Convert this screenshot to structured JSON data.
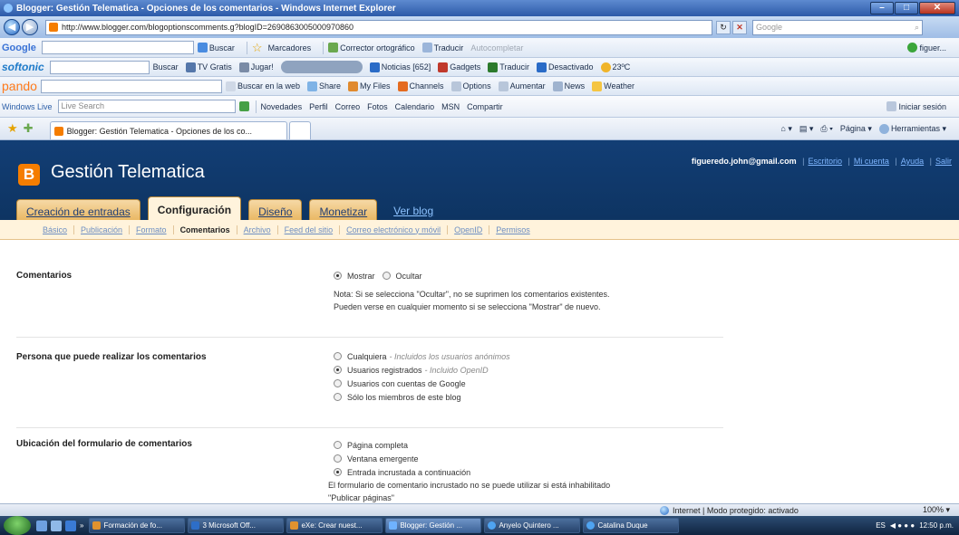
{
  "window": {
    "title": "Blogger: Gestión Telematica - Opciones de los comentarios - Windows Internet Explorer"
  },
  "address_bar": {
    "url": "http://www.blogger.com/blogoptionscomments.g?blogID=2690863005000970860",
    "search_placeholder": "Google"
  },
  "toolbar_google": {
    "brand": "Google",
    "buscar": "Buscar",
    "marcadores": "Marcadores",
    "corrector": "Corrector ortográfico",
    "traducir": "Traducir",
    "autocompletar": "Autocompletar",
    "user": "figuer..."
  },
  "toolbar_softonic": {
    "brand": "softonic",
    "buscar": "Buscar",
    "tvgratis": "TV Gratis",
    "jugar": "Jugar!",
    "noticias": "Noticias [652]",
    "gadgets": "Gadgets",
    "traducir": "Traducir",
    "desactivado": "Desactivado",
    "temp": "23ºC"
  },
  "toolbar_pando": {
    "brand": "pando",
    "buscar_web": "Buscar en la web",
    "share": "Share",
    "myfiles": "My Files",
    "channels": "Channels",
    "options": "Options",
    "aumentar": "Aumentar",
    "news": "News",
    "weather": "Weather"
  },
  "toolbar_wlive": {
    "brand": "Windows Live",
    "search_placeholder": "Live Search",
    "links": [
      "Novedades",
      "Perfil",
      "Correo",
      "Fotos",
      "Calendario",
      "MSN",
      "Compartir"
    ],
    "signin": "Iniciar sesión"
  },
  "tabs_bar": {
    "tab_title": "Blogger: Gestión Telematica - Opciones de los co...",
    "pagina": "Página",
    "herramientas": "Herramientas"
  },
  "blogger": {
    "blog_title": "Gestión Telematica",
    "logo_letter": "B",
    "user_email": "figueredo.john@gmail.com",
    "links": [
      "Escritorio",
      "Mi cuenta",
      "Ayuda",
      "Salir"
    ],
    "main_tabs": [
      "Creación de entradas",
      "Configuración",
      "Diseño",
      "Monetizar"
    ],
    "view_blog": "Ver blog",
    "sub_tabs": [
      "Básico",
      "Publicación",
      "Formato",
      "Comentarios",
      "Archivo",
      "Feed del sitio",
      "Correo electrónico y móvil",
      "OpenID",
      "Permisos"
    ]
  },
  "settings": {
    "comentarios": {
      "label": "Comentarios",
      "options": [
        "Mostrar",
        "Ocultar"
      ],
      "selected": 0,
      "note_line1": "Nota: Si se selecciona \"Ocultar\", no se suprimen los comentarios existentes.",
      "note_line2": "Pueden verse en cualquier momento si se selecciona \"Mostrar\" de nuevo."
    },
    "quien": {
      "label": "Persona que puede realizar los comentarios",
      "options": [
        {
          "text": "Cualquiera",
          "note": "- Incluidos los usuarios anónimos"
        },
        {
          "text": "Usuarios registrados",
          "note": "- Incluido OpenID"
        },
        {
          "text": "Usuarios con cuentas de Google",
          "note": ""
        },
        {
          "text": "Sólo los miembros de este blog",
          "note": ""
        }
      ],
      "selected": 1
    },
    "ubicacion": {
      "label": "Ubicación del formulario de comentarios",
      "options": [
        "Página completa",
        "Ventana emergente",
        "Entrada incrustada a continuación"
      ],
      "selected": 2,
      "note_line1": "El formulario de comentario incrustado no se puede utilizar si está inhabilitado",
      "note_line2": "\"Publicar páginas\""
    }
  },
  "status_bar": {
    "zone": "Internet | Modo protegido: activado",
    "zoom": "100%"
  },
  "taskbar": {
    "tasks": [
      "Formación de fo...",
      "3 Microsoft Off...",
      "eXe: Crear nuest...",
      "Blogger: Gestión ...",
      "Anyelo Quintero ...",
      "Catalina Duque"
    ],
    "lang": "ES",
    "clock": "12:50 p.m."
  }
}
